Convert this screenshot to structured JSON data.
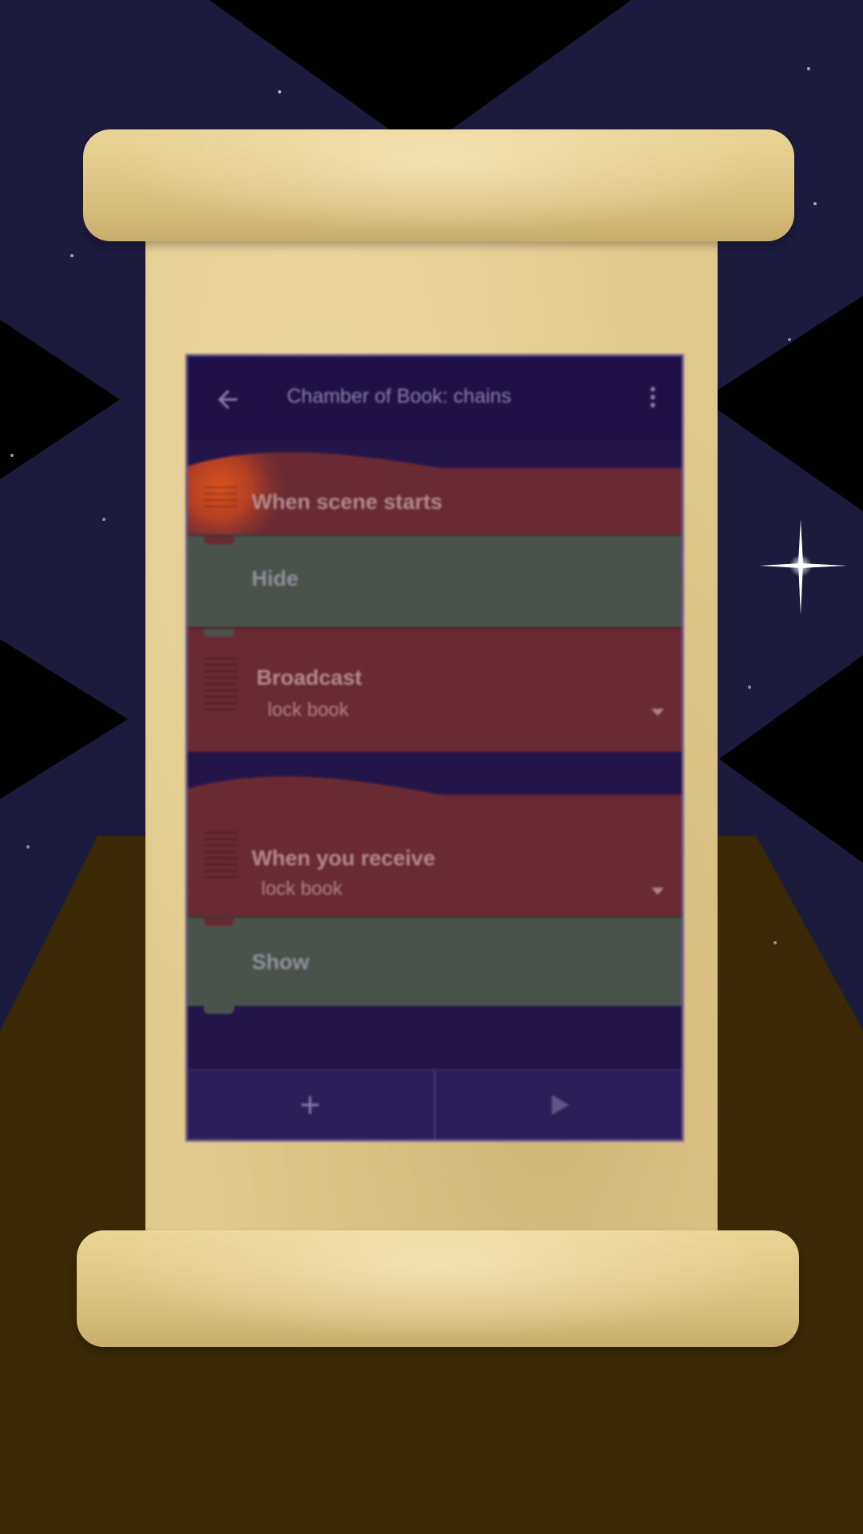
{
  "app_bar": {
    "title": "Chamber of Book: chains",
    "back_icon": "arrow-left-icon",
    "more_icon": "more-vertical-icon"
  },
  "script": {
    "scripts": [
      {
        "event": "When scene starts",
        "bricks": [
          {
            "label": "Hide"
          }
        ],
        "broadcast": {
          "label": "Broadcast",
          "value": "lock book"
        }
      },
      {
        "event": "When you receive",
        "event_value": "lock book",
        "bricks": [
          {
            "label": "Show"
          }
        ]
      }
    ]
  },
  "bottom_bar": {
    "add_icon": "plus-icon",
    "play_icon": "play-icon"
  },
  "colors": {
    "event_brick": "#6a2a33",
    "look_brick": "#4a524c",
    "background": "#221347",
    "parchment": "#e0c98c"
  }
}
